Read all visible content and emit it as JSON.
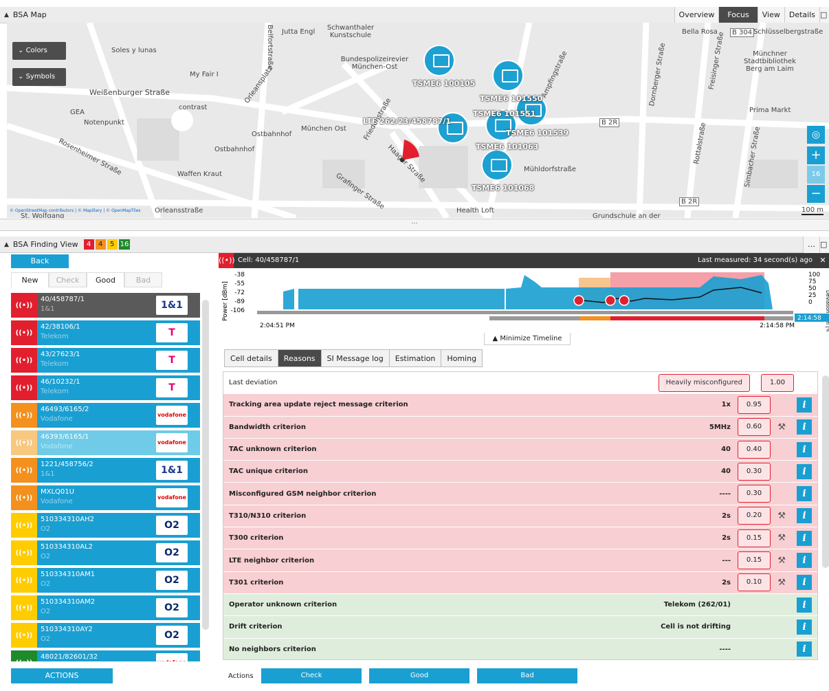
{
  "map_panel": {
    "title": "BSA Map",
    "buttons": [
      "Overview",
      "Focus",
      "View",
      "Details"
    ],
    "colors_label": "Colors",
    "symbols_label": "Symbols",
    "zoom_level": "16",
    "scale": "100 m",
    "attribution": "© OpenStreetMap contributors | © Mapillary | © OpenMapTiles",
    "selected_cell_label": "LTE 262/23/458787/1",
    "streets": [
      "Soles y lunas",
      "Jutta Engl",
      "Schwanthaler Kunstschule",
      "Bundespolizeirevier München-Ost",
      "My Fair I",
      "Weißenburger Straße",
      "GEA",
      "Notenpunkt",
      "contrast",
      "Ostbahnhof",
      "München Ost",
      "Ostbahnhof",
      "Waffen Kraut",
      "Orleansstraße",
      "Grafinger Straße",
      "Haager Straße",
      "Health Loft",
      "Bella Rosa",
      "B 304",
      "Schlüsselbergstraße",
      "Münchner Stadtbibliothek Berg am Laim",
      "Prima Markt",
      "Grundschule an der",
      "St. Wolfgang",
      "B 2R",
      "B 2R",
      "Mühldorfstraße",
      "Rosenheimer Straße",
      "Belfortstraße",
      "Orleansplatz",
      "Friedenstraße",
      "Ampfingstraße",
      "Dornberger Straße",
      "Freisinger Straße",
      "Simbacher Straße",
      "Rottalstraße"
    ],
    "sites": [
      "TSME6 100105",
      "TSME6 101550",
      "TSME6 101551",
      "TSME6 101539",
      "TSME6 101063",
      "TSME6 101068"
    ]
  },
  "finding_view": {
    "title": "BSA Finding View",
    "badges": [
      {
        "value": "4",
        "color": "#e21f2e"
      },
      {
        "value": "4",
        "color": "#f4901e"
      },
      {
        "value": "5",
        "color": "#ffcc00"
      },
      {
        "value": "16",
        "color": "#1f8a2a"
      }
    ],
    "back_label": "Back",
    "filter_tabs": [
      "New",
      "Check",
      "Good",
      "Bad"
    ],
    "actions_label": "ACTIONS",
    "cells": [
      {
        "id": "40/458787/1",
        "operator": "1&1",
        "logo": "1&1",
        "status_color": "#e21f2e",
        "row_color": "#5a5a5a",
        "logo_color": "#1b3a8c"
      },
      {
        "id": "42/38106/1",
        "operator": "Telekom",
        "logo": "T",
        "status_color": "#e21f2e",
        "row_color": "#1a9fd2",
        "logo_color": "#e20074"
      },
      {
        "id": "43/27623/1",
        "operator": "Telekom",
        "logo": "T",
        "status_color": "#e21f2e",
        "row_color": "#1a9fd2",
        "logo_color": "#e20074"
      },
      {
        "id": "46/10232/1",
        "operator": "Telekom",
        "logo": "T",
        "status_color": "#e21f2e",
        "row_color": "#1a9fd2",
        "logo_color": "#e20074"
      },
      {
        "id": "46493/6165/2",
        "operator": "Vodafone",
        "logo": "vodafone",
        "status_color": "#f4901e",
        "row_color": "#1a9fd2",
        "logo_color": "#e60000"
      },
      {
        "id": "46393/6165/1",
        "operator": "Vodafone",
        "logo": "vodafone",
        "status_color": "#f8c87f",
        "row_color": "#6fcbe8",
        "logo_color": "#e60000"
      },
      {
        "id": "1221/458756/2",
        "operator": "1&1",
        "logo": "1&1",
        "status_color": "#f4901e",
        "row_color": "#1a9fd2",
        "logo_color": "#1b3a8c"
      },
      {
        "id": "MXLQ01U",
        "operator": "Vodafone",
        "logo": "vodafone",
        "status_color": "#f4901e",
        "row_color": "#1a9fd2",
        "logo_color": "#e60000"
      },
      {
        "id": "510334310AH2",
        "operator": "O2",
        "logo": "O2",
        "status_color": "#ffcc00",
        "row_color": "#1a9fd2",
        "logo_color": "#0a2a6b"
      },
      {
        "id": "510334310AL2",
        "operator": "O2",
        "logo": "O2",
        "status_color": "#ffcc00",
        "row_color": "#1a9fd2",
        "logo_color": "#0a2a6b"
      },
      {
        "id": "510334310AM1",
        "operator": "O2",
        "logo": "O2",
        "status_color": "#ffcc00",
        "row_color": "#1a9fd2",
        "logo_color": "#0a2a6b"
      },
      {
        "id": "510334310AM2",
        "operator": "O2",
        "logo": "O2",
        "status_color": "#ffcc00",
        "row_color": "#1a9fd2",
        "logo_color": "#0a2a6b"
      },
      {
        "id": "510334310AY2",
        "operator": "O2",
        "logo": "O2",
        "status_color": "#ffcc00",
        "row_color": "#1a9fd2",
        "logo_color": "#0a2a6b"
      },
      {
        "id": "48021/82601/32",
        "operator": "Vodafone",
        "logo": "vodafone",
        "status_color": "#1f8a2a",
        "row_color": "#1a9fd2",
        "logo_color": "#e60000"
      }
    ]
  },
  "detail": {
    "cell_title": "Cell: 40/458787/1",
    "last_measured": "Last measured: 34 second(s) ago",
    "timeline": {
      "y_label": "Power [dBm]",
      "y_ticks": [
        "-38",
        "-55",
        "-72",
        "-89",
        "-106"
      ],
      "right_label": "Deviationlevel [%]",
      "right_ticks": [
        "100",
        "75",
        "50",
        "25",
        "0"
      ],
      "start_time": "2:04:51 PM",
      "end_time": "2:14:58 PM",
      "current_time": "2:14:58",
      "minimize_label": "Minimize Timeline"
    },
    "tabs": [
      "Cell details",
      "Reasons",
      "SI Message log",
      "Estimation",
      "Homing"
    ],
    "active_tab": "Reasons",
    "last_deviation": {
      "label": "Last deviation",
      "status": "Heavily misconfigured",
      "value": "1.00"
    },
    "criteria": [
      {
        "name": "Tracking area update reject message criterion",
        "value": "1x",
        "score": "0.95",
        "wand": false,
        "kind": "pink"
      },
      {
        "name": "Bandwidth criterion",
        "value": "5MHz",
        "score": "0.60",
        "wand": true,
        "kind": "pink"
      },
      {
        "name": "TAC unknown criterion",
        "value": "40",
        "score": "0.40",
        "wand": false,
        "kind": "pink"
      },
      {
        "name": "TAC unique criterion",
        "value": "40",
        "score": "0.30",
        "wand": false,
        "kind": "pink"
      },
      {
        "name": "Misconfigured GSM neighbor criterion",
        "value": "----",
        "score": "0.30",
        "wand": false,
        "kind": "pink"
      },
      {
        "name": "T310/N310 criterion",
        "value": "2s",
        "score": "0.20",
        "wand": true,
        "kind": "pink"
      },
      {
        "name": "T300 criterion",
        "value": "2s",
        "score": "0.15",
        "wand": true,
        "kind": "pink"
      },
      {
        "name": "LTE neighbor criterion",
        "value": "---",
        "score": "0.15",
        "wand": true,
        "kind": "pink"
      },
      {
        "name": "T301 criterion",
        "value": "2s",
        "score": "0.10",
        "wand": true,
        "kind": "pink"
      },
      {
        "name": "Operator unknown criterion",
        "value": "Telekom (262/01)",
        "score": "",
        "wand": false,
        "kind": "green"
      },
      {
        "name": "Drift criterion",
        "value": "Cell is not drifting",
        "score": "",
        "wand": false,
        "kind": "green"
      },
      {
        "name": "No neighbors criterion",
        "value": "----",
        "score": "",
        "wand": false,
        "kind": "green"
      }
    ],
    "actions_label": "Actions",
    "action_buttons": [
      "Check",
      "Good",
      "Bad"
    ]
  }
}
